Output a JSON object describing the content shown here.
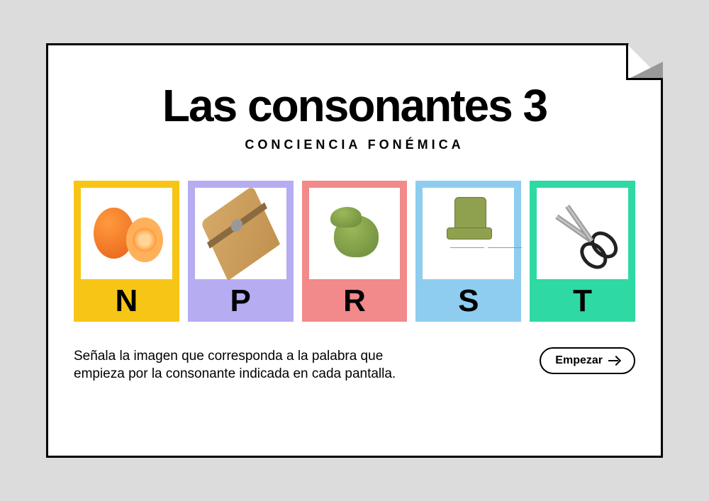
{
  "title": "Las consonantes 3",
  "subtitle": "CONCIENCIA FONÉMICA",
  "cards": [
    {
      "letter": "N",
      "image": "naranja",
      "color": "#f7c516"
    },
    {
      "letter": "P",
      "image": "pinza",
      "color": "#b6acf2"
    },
    {
      "letter": "R",
      "image": "rana",
      "color": "#f2898a"
    },
    {
      "letter": "S",
      "image": "silla",
      "color": "#8ecdf0"
    },
    {
      "letter": "T",
      "image": "tijeras",
      "color": "#2ed9a4"
    }
  ],
  "instructions": "Señala la imagen que corresponda a la palabra que empieza por la consonante indicada en cada pantalla.",
  "start_button": "Empezar"
}
